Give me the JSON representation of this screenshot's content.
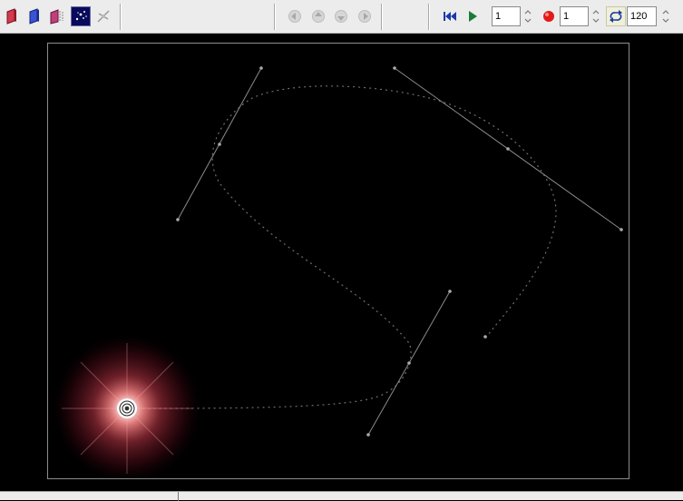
{
  "toolbar": {
    "tools": [
      {
        "icon": "red-layer-icon",
        "color": "#d43a4e"
      },
      {
        "icon": "blue-layer-icon",
        "color": "#3a53d4"
      },
      {
        "icon": "layer-frames-icon",
        "color": "#c0407a"
      },
      {
        "icon": "particles-icon",
        "color": "#1a1a6a",
        "active": true
      },
      {
        "icon": "move-handle-icon",
        "color": "#9a9a9a"
      }
    ],
    "nav_arrows": [
      "arrow-left-icon",
      "arrow-up-icon",
      "arrow-down-icon",
      "arrow-right-icon"
    ],
    "playback": {
      "rewind_icon": "rewind-icon",
      "play_icon": "play-icon",
      "frame_value": "1",
      "record_icon": "record-icon",
      "record_value": "1",
      "loop_icon": "loop-icon",
      "loop_value": "120"
    }
  },
  "colors": {
    "toolbar_bg": "#ececec",
    "canvas_bg": "#000000",
    "path_dots": "#6f6f6f",
    "handle_lines": "#8a8a8a",
    "glow_core": "#ffffff",
    "glow_outer": "#ff3a55"
  }
}
